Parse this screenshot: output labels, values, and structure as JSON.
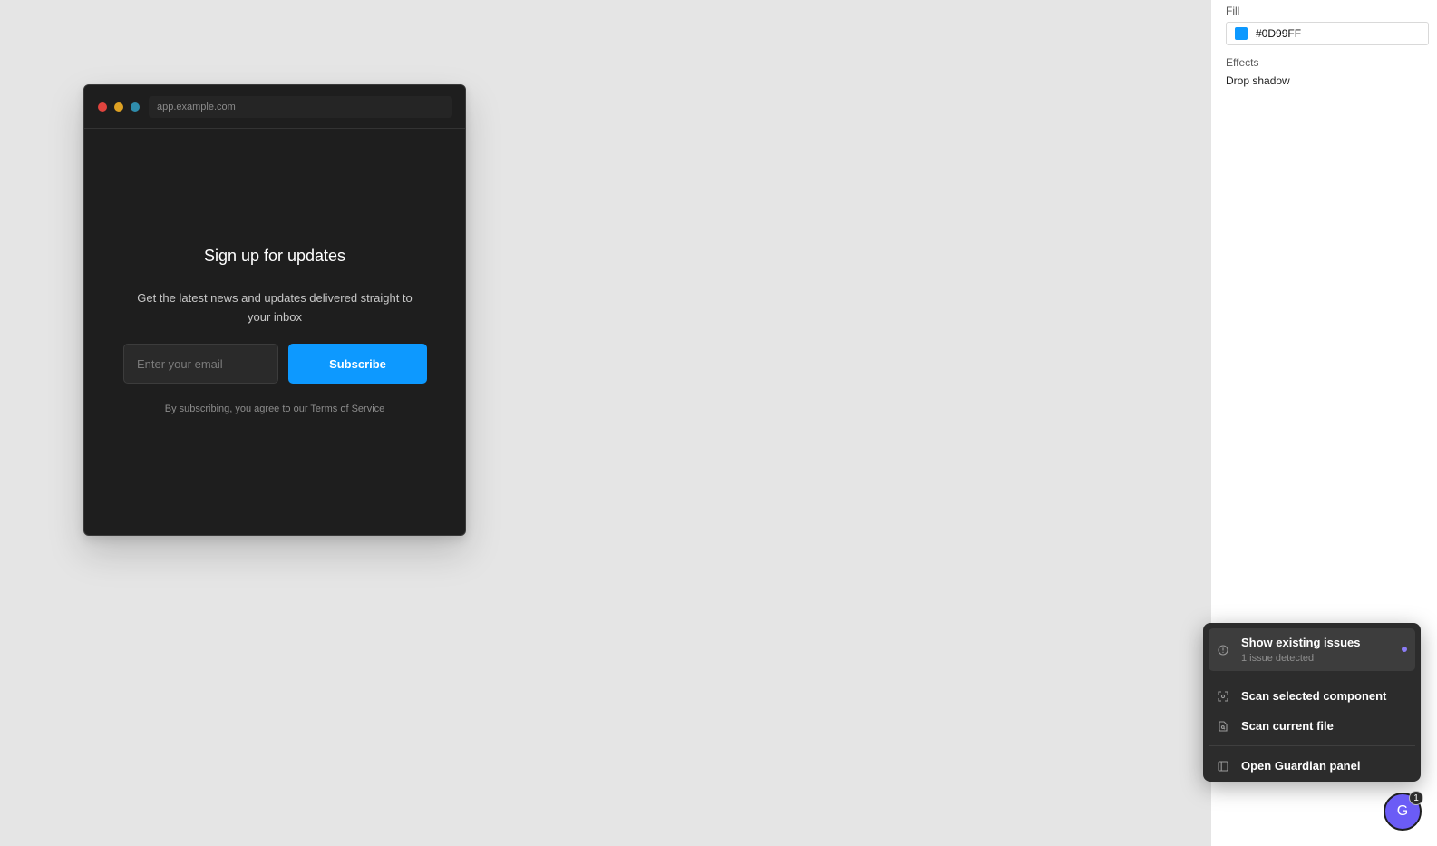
{
  "browser": {
    "url": "app.example.com"
  },
  "signup": {
    "title": "Sign up for updates",
    "description": "Get the latest news and updates delivered straight to your inbox",
    "email_placeholder": "Enter your email",
    "subscribe_label": "Subscribe",
    "terms": "By subscribing, you agree to our Terms of Service"
  },
  "panel": {
    "fill_label": "Fill",
    "fill_hex": "#0D99FF",
    "fill_color": "#0D99FF",
    "effects_label": "Effects",
    "effect_item": "Drop shadow"
  },
  "menu": {
    "show_issues": "Show existing issues",
    "issues_sub": "1 issue detected",
    "scan_component": "Scan selected component",
    "scan_file": "Scan current file",
    "open_panel": "Open Guardian panel"
  },
  "avatar": {
    "initial": "G",
    "badge": "1"
  },
  "colors": {
    "accent": "#0D99FF",
    "guardian": "#6B5CF6"
  }
}
